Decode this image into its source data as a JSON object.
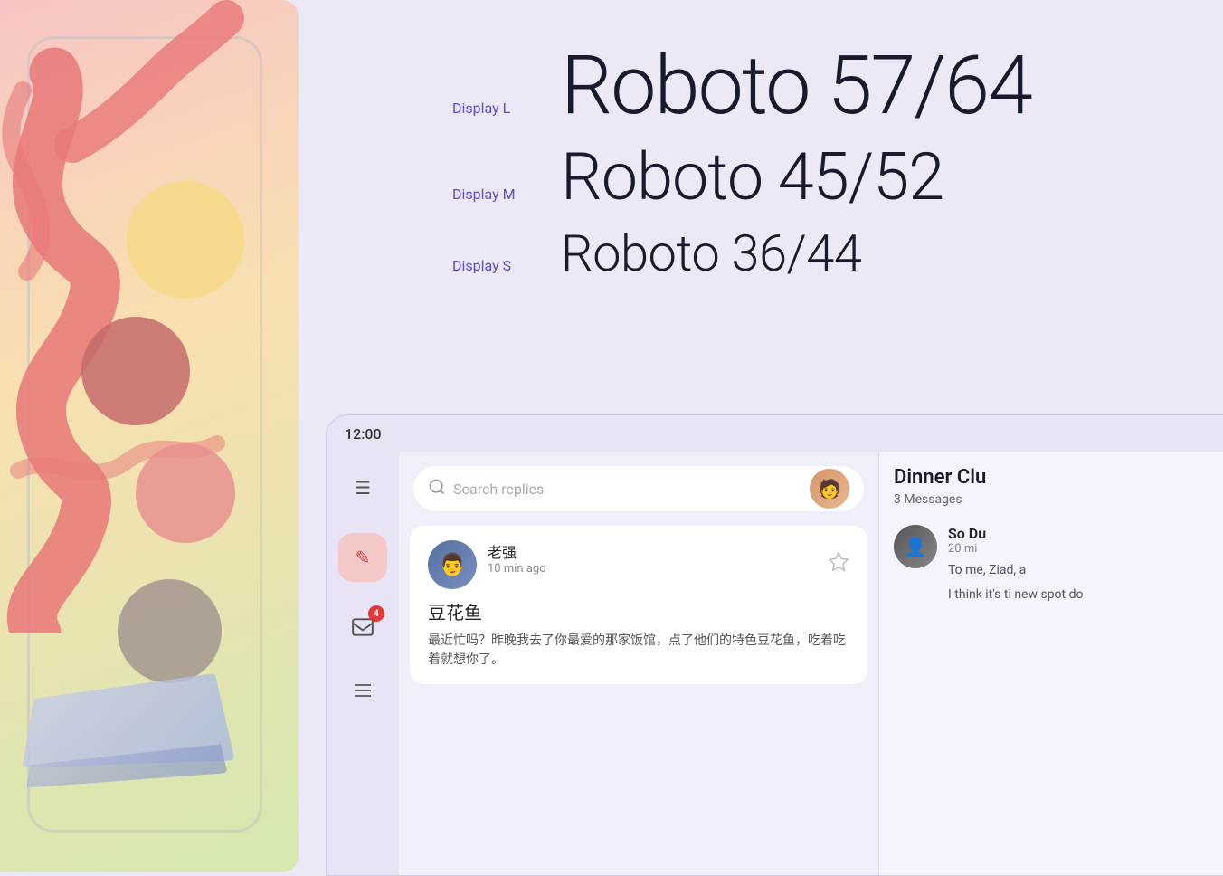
{
  "illustration": {
    "alt": "Abstract decorative illustration with organic shapes"
  },
  "typography": {
    "display_l": {
      "label": "Display L",
      "text": "Roboto 57/64"
    },
    "display_m": {
      "label": "Display M",
      "text": "Roboto 45/52"
    },
    "display_s": {
      "label": "Display S",
      "text": "Roboto 36/44"
    }
  },
  "app_mockup": {
    "status_bar": {
      "time": "12:00"
    },
    "sidebar": {
      "fab_icon": "✏",
      "inbox_icon": "📨",
      "inbox_badge": "4",
      "list_icon": "☰",
      "menu_icon": "☰"
    },
    "search": {
      "placeholder": "Search replies",
      "icon": "🔍"
    },
    "message": {
      "sender": "老强",
      "time_ago": "10 min ago",
      "subject": "豆花鱼",
      "preview": "最近忙吗？昨晚我去了你最爱的那家饭馆，点了他们的特色豆花鱼，吃着吃着就想你了。"
    },
    "detail_panel": {
      "title": "Dinner Clu",
      "message_count": "3 Messages",
      "email_sender": "So Du",
      "email_time": "20 mi",
      "email_to": "To me, Ziad, a",
      "email_body": "I think it's ti new spot do"
    }
  }
}
